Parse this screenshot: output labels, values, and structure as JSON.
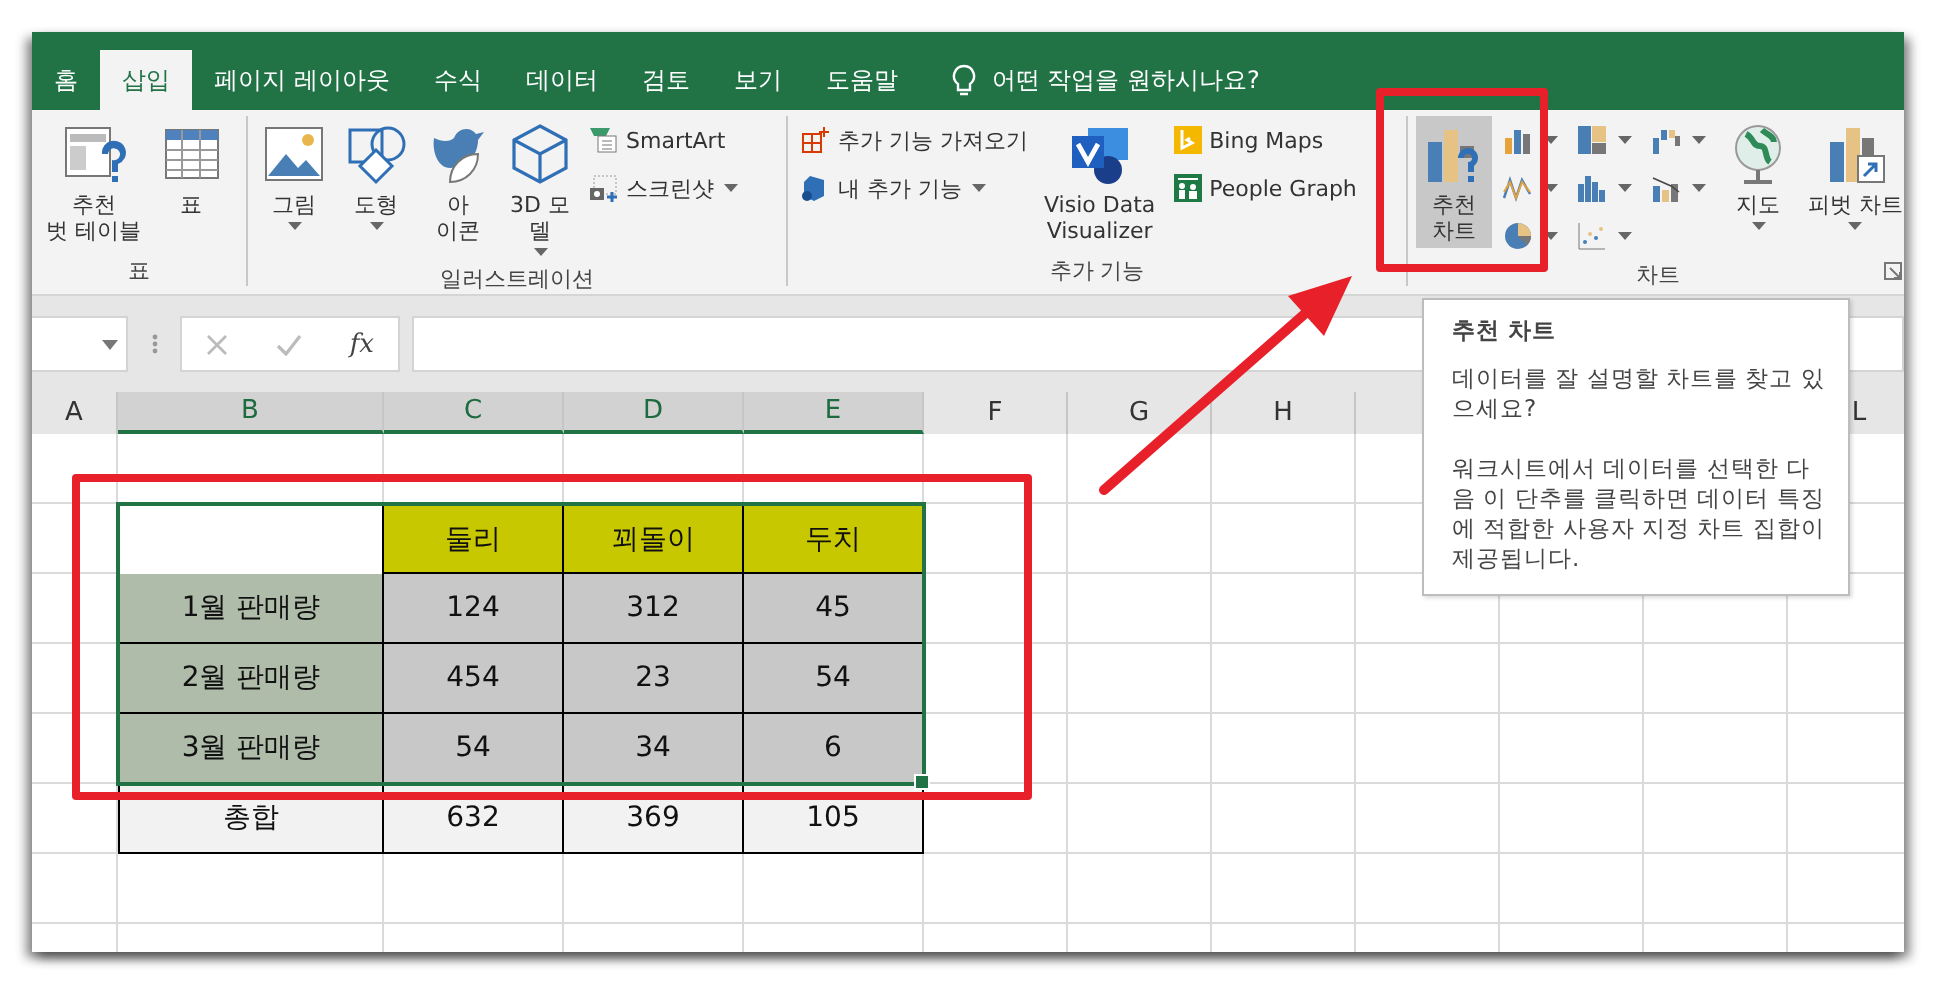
{
  "tabs": [
    {
      "label": "홈",
      "selected": false
    },
    {
      "label": "삽입",
      "selected": true
    },
    {
      "label": "페이지 레이아웃",
      "selected": false
    },
    {
      "label": "수식",
      "selected": false
    },
    {
      "label": "데이터",
      "selected": false
    },
    {
      "label": "검토",
      "selected": false
    },
    {
      "label": "보기",
      "selected": false
    },
    {
      "label": "도움말",
      "selected": false
    }
  ],
  "tell_me": {
    "label": "어떤 작업을 원하시나요?"
  },
  "ribbon_groups": [
    {
      "label": "표",
      "launcher": false,
      "columns": [
        [
          {
            "kind": "pivot-table",
            "lines": [
              "추천",
              "벗 테이블"
            ],
            "dropdown": false,
            "highlighted": false
          }
        ],
        [
          {
            "kind": "table",
            "lines": [
              "표"
            ],
            "dropdown": false,
            "highlighted": false
          }
        ]
      ]
    },
    {
      "label": "일러스트레이션",
      "launcher": false,
      "columns": [
        [
          {
            "kind": "picture",
            "lines": [
              "그림"
            ],
            "dropdown": true,
            "highlighted": false
          }
        ],
        [
          {
            "kind": "shapes",
            "lines": [
              "도형"
            ],
            "dropdown": true,
            "highlighted": false
          }
        ],
        [
          {
            "kind": "bird",
            "lines": [
              "아",
              "이콘"
            ],
            "dropdown": false,
            "highlighted": false
          }
        ],
        [
          {
            "kind": "cube",
            "lines": [
              "3D 모",
              "델"
            ],
            "dropdown": true,
            "highlighted": false
          }
        ],
        [
          {
            "kind": "smartart",
            "lines": [
              "SmartArt"
            ],
            "dropdown": false,
            "highlighted": false
          },
          {
            "kind": "screenshot",
            "lines": [
              "스크린샷"
            ],
            "dropdown": true,
            "highlighted": false
          }
        ]
      ]
    },
    {
      "label": "추가 기능",
      "launcher": false,
      "columns": [
        [
          {
            "kind": "store",
            "lines": [
              "추가 기능 가져오기"
            ],
            "dropdown": false,
            "highlighted": false
          },
          {
            "kind": "addins",
            "lines": [
              "내 추가 기능"
            ],
            "dropdown": true,
            "highlighted": false
          }
        ],
        [
          {
            "kind": "visio",
            "lines": [
              "Visio Data",
              "Visualizer"
            ],
            "dropdown": false,
            "highlighted": false
          }
        ],
        [
          {
            "kind": "bing",
            "lines": [
              "Bing Maps"
            ],
            "dropdown": false,
            "highlighted": false
          },
          {
            "kind": "people",
            "lines": [
              "People Graph"
            ],
            "dropdown": false,
            "highlighted": false
          }
        ]
      ]
    },
    {
      "label": "차트",
      "launcher": true,
      "columns": [
        [
          {
            "kind": "recommended-chart",
            "lines": [
              "추천",
              "차트"
            ],
            "dropdown": false,
            "highlighted": true
          }
        ],
        [
          {
            "kind": "column-chart",
            "dropdown": true,
            "highlighted": false
          },
          {
            "kind": "line-chart",
            "dropdown": true,
            "highlighted": false
          },
          {
            "kind": "pie-chart",
            "dropdown": true,
            "highlighted": false
          }
        ],
        [
          {
            "kind": "treemap-chart",
            "dropdown": true,
            "highlighted": false
          },
          {
            "kind": "histogram-chart",
            "dropdown": true,
            "highlighted": false
          },
          {
            "kind": "scatter-chart",
            "dropdown": true,
            "highlighted": false
          }
        ],
        [
          {
            "kind": "waterfall-chart",
            "dropdown": true,
            "highlighted": false
          },
          {
            "kind": "combo-chart",
            "dropdown": true,
            "highlighted": false
          }
        ],
        [
          {
            "kind": "globe",
            "lines": [
              "지도"
            ],
            "dropdown": true,
            "highlighted": false
          }
        ],
        [
          {
            "kind": "pivot-chart",
            "lines": [
              "피벗 차트"
            ],
            "dropdown": true,
            "highlighted": false
          }
        ]
      ]
    }
  ],
  "formula_bar": {
    "function_label": "fx"
  },
  "sheet": {
    "columns": [
      {
        "label": "A",
        "selected": false
      },
      {
        "label": "B",
        "selected": true
      },
      {
        "label": "C",
        "selected": true
      },
      {
        "label": "D",
        "selected": true
      },
      {
        "label": "E",
        "selected": true
      },
      {
        "label": "F",
        "selected": false
      },
      {
        "label": "G",
        "selected": false
      },
      {
        "label": "H",
        "selected": false
      },
      {
        "label": "L",
        "selected": false
      }
    ],
    "table": [
      {
        "kind": "header",
        "selected": true,
        "values": [
          "둘리",
          "꾀돌이",
          "두치"
        ]
      },
      {
        "kind": "data",
        "selected": true,
        "label": "1월 판매량",
        "values": [
          "124",
          "312",
          "45"
        ]
      },
      {
        "kind": "data",
        "selected": true,
        "label": "2월 판매량",
        "values": [
          "454",
          "23",
          "54"
        ]
      },
      {
        "kind": "data",
        "selected": true,
        "label": "3월 판매량",
        "values": [
          "54",
          "34",
          "6"
        ]
      },
      {
        "kind": "total",
        "selected": false,
        "label": "총합",
        "values": [
          "632",
          "369",
          "105"
        ]
      }
    ]
  },
  "tooltip": {
    "title": "추천 차트",
    "paragraphs": [
      "데이터를 잘 설명할 차트를 찾고 있으세요?",
      "워크시트에서 데이터를 선택한 다음 이 단추를 클릭하면 데이터 특징에 적합한 사용자 지정 차트 집합이 제공됩니다."
    ]
  }
}
